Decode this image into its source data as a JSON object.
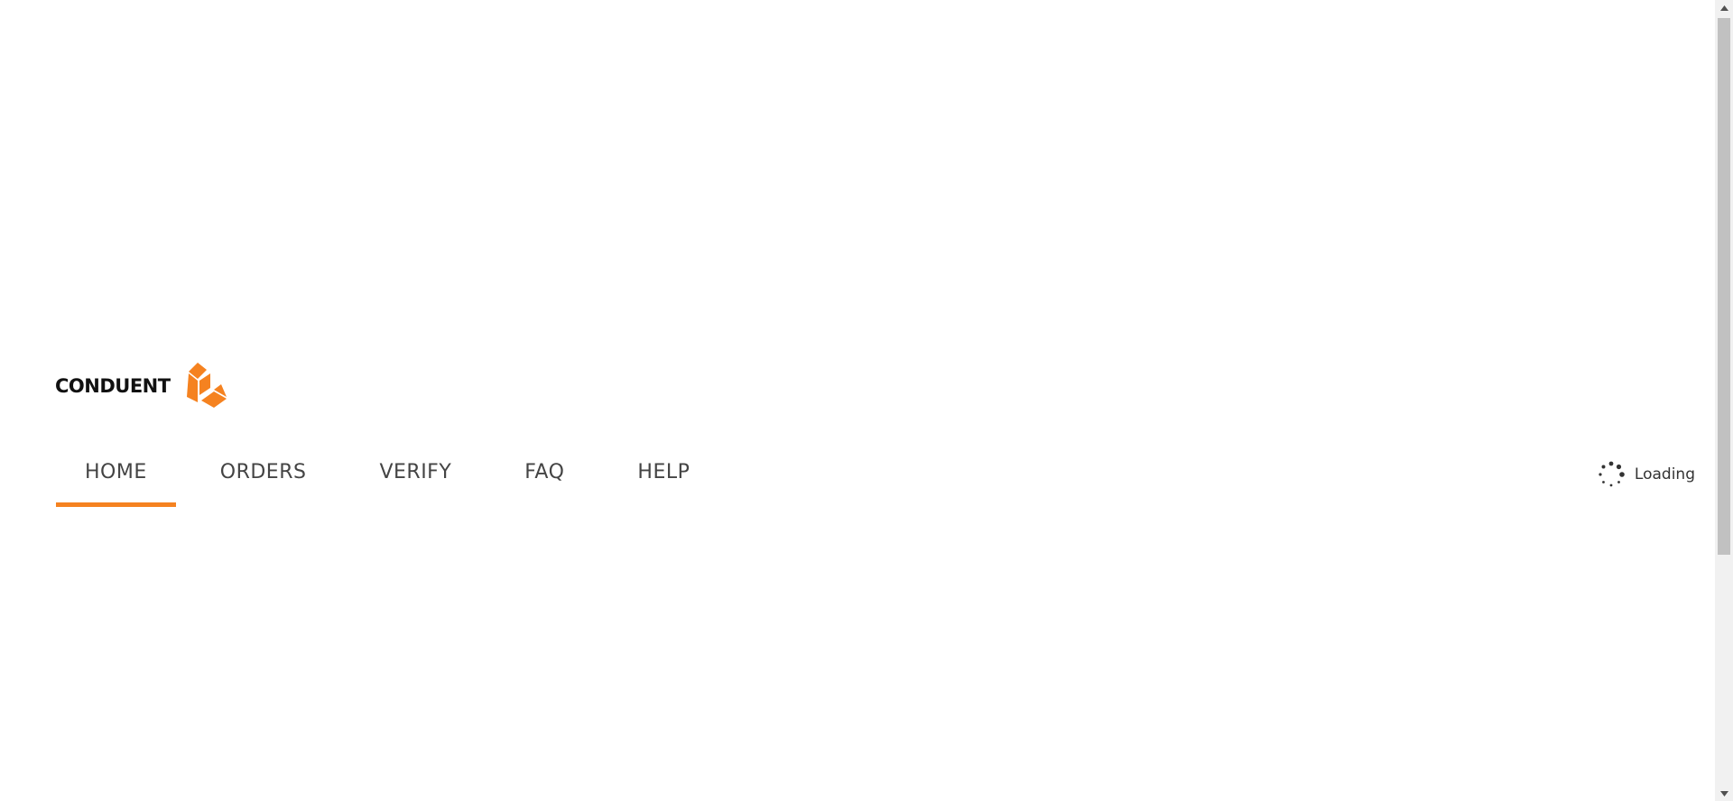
{
  "brand": {
    "name": "CONDUENT",
    "accent_color": "#f58220",
    "logo_icon": "conduent-cube-icon"
  },
  "nav": {
    "items": [
      {
        "label": "HOME",
        "active": true
      },
      {
        "label": "ORDERS",
        "active": false
      },
      {
        "label": "VERIFY",
        "active": false
      },
      {
        "label": "FAQ",
        "active": false
      },
      {
        "label": "HELP",
        "active": false
      }
    ]
  },
  "status": {
    "loading_text": "Loading",
    "icon": "spinner-icon"
  },
  "scrollbar": {
    "up_icon": "scroll-up-arrow-icon",
    "down_icon": "scroll-down-arrow-icon"
  }
}
